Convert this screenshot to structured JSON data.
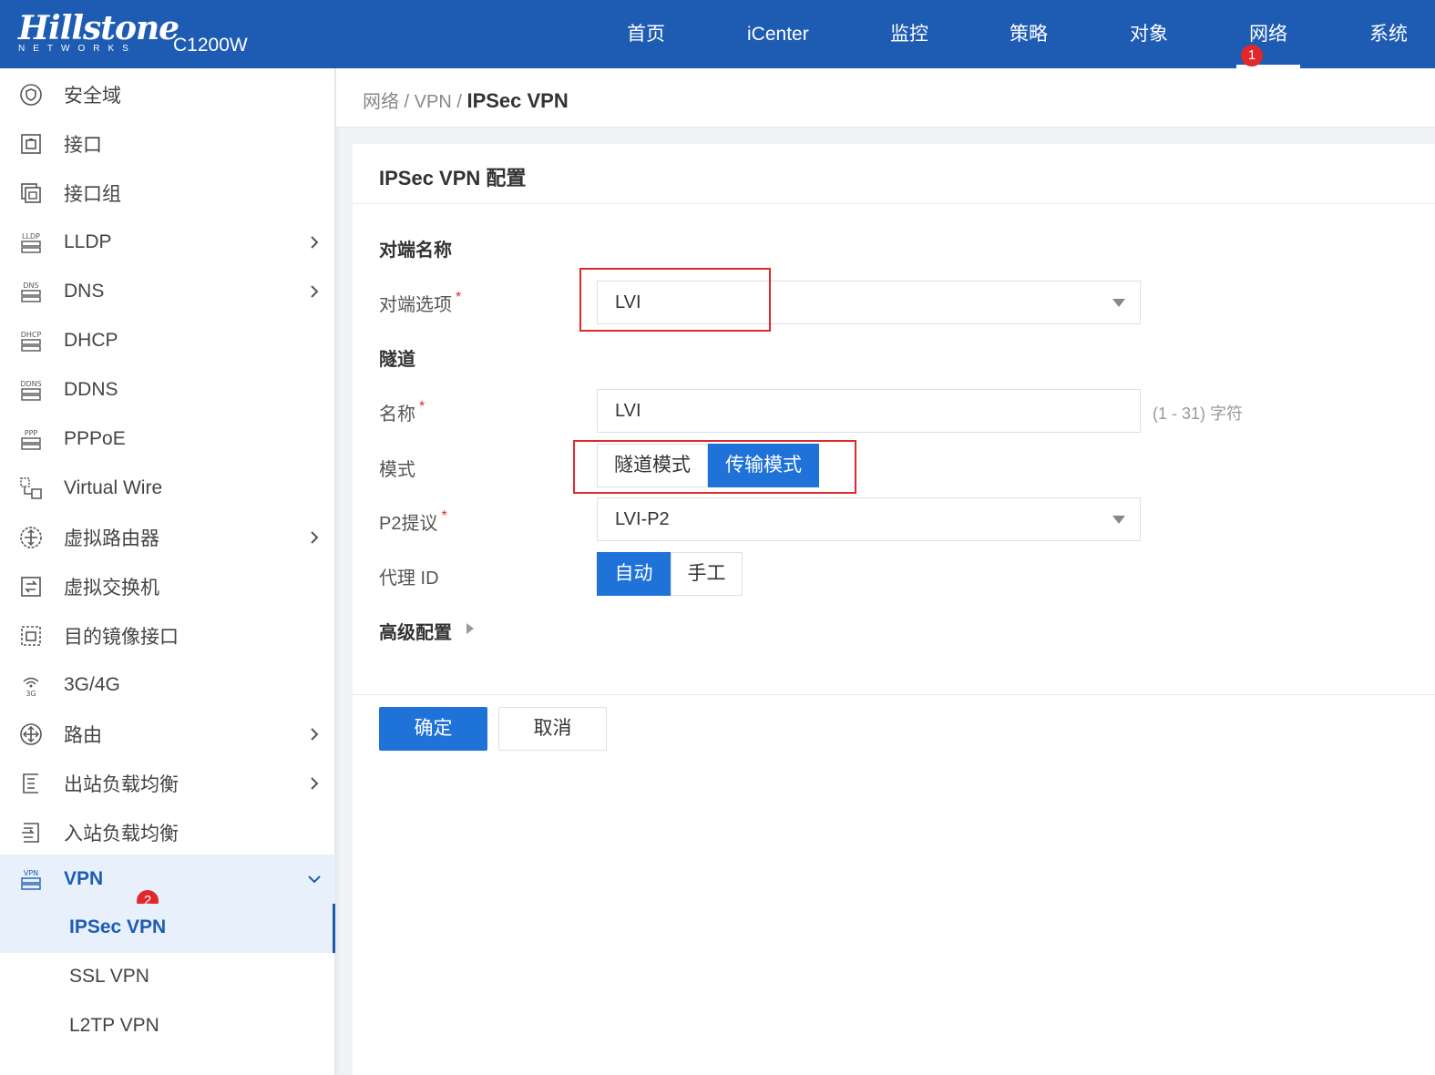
{
  "header": {
    "logo_main": "Hillstone",
    "logo_sub": "NETWORKS",
    "model": "C1200W",
    "nav": [
      {
        "label": "首页"
      },
      {
        "label": "iCenter"
      },
      {
        "label": "监控"
      },
      {
        "label": "策略"
      },
      {
        "label": "对象"
      },
      {
        "label": "网络"
      },
      {
        "label": "系统"
      }
    ],
    "active_nav": "网络",
    "badge_1": "1"
  },
  "sidebar": {
    "items": [
      {
        "label": "安全域",
        "icon": "shield-icon"
      },
      {
        "label": "接口",
        "icon": "port-icon"
      },
      {
        "label": "接口组",
        "icon": "port-group-icon"
      },
      {
        "label": "LLDP",
        "icon": "lldp-icon",
        "icon_text": "LLDP"
      },
      {
        "label": "DNS",
        "icon": "dns-icon",
        "icon_text": "DNS"
      },
      {
        "label": "DHCP",
        "icon": "dhcp-icon",
        "icon_text": "DHCP"
      },
      {
        "label": "DDNS",
        "icon": "ddns-icon",
        "icon_text": "DDNS"
      },
      {
        "label": "PPPoE",
        "icon": "pppoe-icon",
        "icon_text": "PPP"
      },
      {
        "label": "Virtual Wire",
        "icon": "virtual-wire-icon"
      },
      {
        "label": "虚拟路由器",
        "icon": "virtual-router-icon"
      },
      {
        "label": "虚拟交换机",
        "icon": "virtual-switch-icon"
      },
      {
        "label": "目的镜像接口",
        "icon": "mirror-port-icon"
      },
      {
        "label": "3G/4G",
        "icon": "wireless-3g-icon",
        "icon_text": "3G"
      },
      {
        "label": "路由",
        "icon": "route-icon"
      },
      {
        "label": "出站负载均衡",
        "icon": "outbound-lb-icon"
      },
      {
        "label": "入站负载均衡",
        "icon": "inbound-lb-icon"
      },
      {
        "label": "VPN",
        "icon": "vpn-icon",
        "icon_text": "VPN"
      }
    ],
    "vpn_sub": [
      {
        "label": "IPSec VPN"
      },
      {
        "label": "SSL VPN"
      },
      {
        "label": "L2TP VPN"
      }
    ],
    "badge_2": "2"
  },
  "breadcrumb": {
    "part1": "网络",
    "sep": " / ",
    "part2": "VPN",
    "current": "IPSec VPN"
  },
  "form": {
    "title": "IPSec VPN 配置",
    "section_peer": "对端名称",
    "peer_option_label": "对端选项",
    "peer_option_value": "LVI",
    "section_tunnel": "隧道",
    "name_label": "名称",
    "name_value": "LVI",
    "name_hint": "(1 - 31) 字符",
    "mode_label": "模式",
    "mode_tunnel": "隧道模式",
    "mode_transport": "传输模式",
    "p2_label": "P2提议",
    "p2_value": "LVI-P2",
    "proxy_label": "代理 ID",
    "proxy_auto": "自动",
    "proxy_manual": "手工",
    "advanced": "高级配置",
    "required_mark": "*",
    "ok": "确定",
    "cancel": "取消"
  },
  "colors": {
    "header_bg": "#1e5cb3",
    "primary": "#1e72d8",
    "highlight_box": "#e0282d"
  }
}
